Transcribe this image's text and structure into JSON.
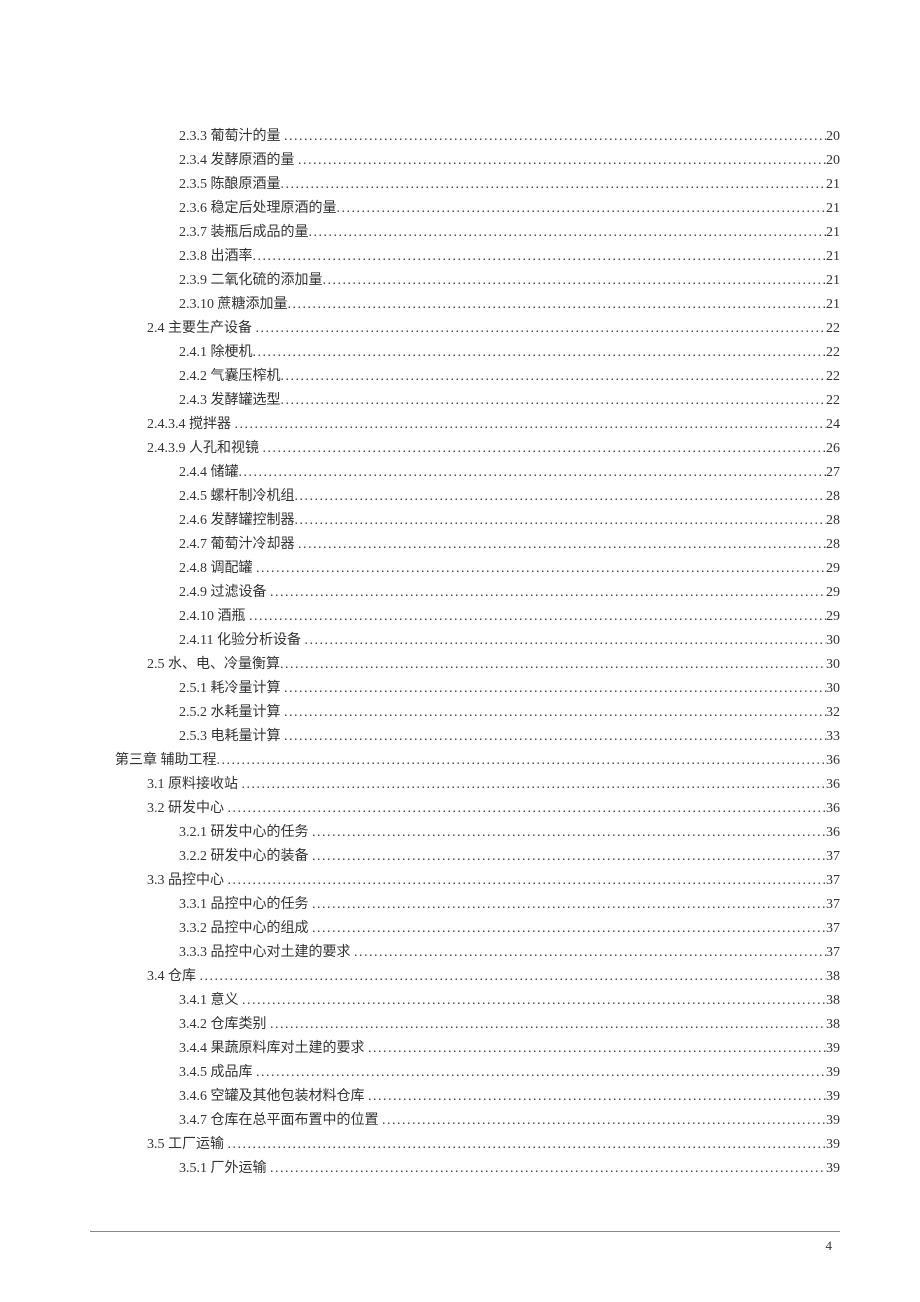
{
  "footer_page": "4",
  "toc": [
    {
      "indent": "2",
      "label": "2.3.3 葡萄汁的量 ",
      "page": "20"
    },
    {
      "indent": "2",
      "label": "2.3.4 发酵原酒的量 ",
      "page": "20"
    },
    {
      "indent": "2",
      "label": "2.3.5 陈酿原酒量",
      "page": "21"
    },
    {
      "indent": "2",
      "label": "2.3.6 稳定后处理原酒的量",
      "page": "21"
    },
    {
      "indent": "2",
      "label": "2.3.7 装瓶后成品的量",
      "page": "21"
    },
    {
      "indent": "2",
      "label": "2.3.8 出酒率",
      "page": "21"
    },
    {
      "indent": "2",
      "label": "2.3.9 二氧化硫的添加量",
      "page": "21"
    },
    {
      "indent": "2",
      "label": "2.3.10 蔗糖添加量",
      "page": "21"
    },
    {
      "indent": "1",
      "label": "2.4 主要生产设备 ",
      "page": "22"
    },
    {
      "indent": "2",
      "label": "2.4.1 除梗机",
      "page": "22"
    },
    {
      "indent": "2",
      "label": "2.4.2 气囊压榨机",
      "page": "22"
    },
    {
      "indent": "2",
      "label": "2.4.3 发酵罐选型",
      "page": "22"
    },
    {
      "indent": "2b",
      "label": "2.4.3.4 搅拌器 ",
      "page": "24"
    },
    {
      "indent": "2b",
      "label": "2.4.3.9 人孔和视镜 ",
      "page": "26"
    },
    {
      "indent": "2",
      "label": "2.4.4 储罐",
      "page": "27"
    },
    {
      "indent": "2",
      "label": "2.4.5 螺杆制冷机组",
      "page": "28"
    },
    {
      "indent": "2",
      "label": "2.4.6 发酵罐控制器",
      "page": "28"
    },
    {
      "indent": "2",
      "label": "2.4.7 葡萄汁冷却器 ",
      "page": "28"
    },
    {
      "indent": "2",
      "label": "2.4.8 调配罐 ",
      "page": "29"
    },
    {
      "indent": "2",
      "label": "2.4.9 过滤设备 ",
      "page": "29"
    },
    {
      "indent": "2",
      "label": "2.4.10 酒瓶 ",
      "page": "29"
    },
    {
      "indent": "2",
      "label": "2.4.11 化验分析设备 ",
      "page": "30"
    },
    {
      "indent": "1",
      "label": "2.5 水、电、冷量衡算",
      "page": "30"
    },
    {
      "indent": "2",
      "label": "2.5.1 耗冷量计算 ",
      "page": "30"
    },
    {
      "indent": "2",
      "label": "2.5.2 水耗量计算 ",
      "page": "32"
    },
    {
      "indent": "2",
      "label": "2.5.3 电耗量计算 ",
      "page": "33"
    },
    {
      "indent": "0",
      "label": "第三章 辅助工程",
      "page": "36"
    },
    {
      "indent": "1",
      "label": "3.1 原料接收站 ",
      "page": "36"
    },
    {
      "indent": "1",
      "label": "3.2 研发中心 ",
      "page": "36"
    },
    {
      "indent": "2",
      "label": "3.2.1 研发中心的任务 ",
      "page": "36"
    },
    {
      "indent": "2",
      "label": "3.2.2 研发中心的装备 ",
      "page": "37"
    },
    {
      "indent": "1",
      "label": "3.3 品控中心 ",
      "page": "37"
    },
    {
      "indent": "2",
      "label": "3.3.1 品控中心的任务 ",
      "page": "37"
    },
    {
      "indent": "2",
      "label": "3.3.2 品控中心的组成 ",
      "page": "37"
    },
    {
      "indent": "2",
      "label": "3.3.3 品控中心对土建的要求 ",
      "page": "37"
    },
    {
      "indent": "1",
      "label": "3.4 仓库 ",
      "page": "38"
    },
    {
      "indent": "2",
      "label": "3.4.1 意义 ",
      "page": "38"
    },
    {
      "indent": "2",
      "label": "3.4.2 仓库类别 ",
      "page": "38"
    },
    {
      "indent": "2",
      "label": "3.4.4 果蔬原料库对土建的要求 ",
      "page": "39"
    },
    {
      "indent": "2",
      "label": "3.4.5 成品库 ",
      "page": "39"
    },
    {
      "indent": "2",
      "label": "3.4.6 空罐及其他包装材料仓库 ",
      "page": "39"
    },
    {
      "indent": "2",
      "label": "3.4.7 仓库在总平面布置中的位置 ",
      "page": "39"
    },
    {
      "indent": "1",
      "label": "3.5 工厂运输 ",
      "page": "39"
    },
    {
      "indent": "2",
      "label": "3.5.1 厂外运输 ",
      "page": "39"
    }
  ]
}
